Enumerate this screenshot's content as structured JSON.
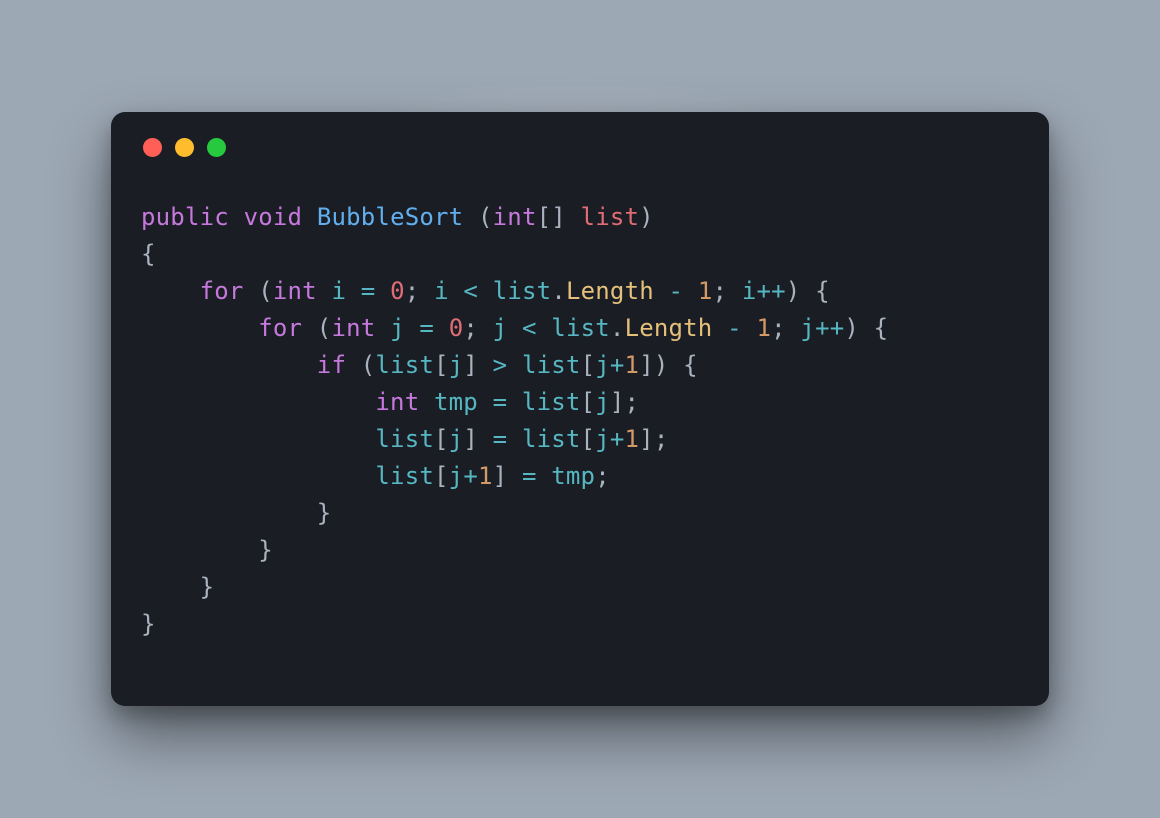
{
  "window": {
    "traffic_lights": [
      "red",
      "yellow",
      "green"
    ]
  },
  "code": {
    "tokens": [
      [
        [
          "k",
          "public"
        ],
        [
          "p",
          " "
        ],
        [
          "k",
          "void"
        ],
        [
          "p",
          " "
        ],
        [
          "fn",
          "BubbleSort"
        ],
        [
          "p",
          " ("
        ],
        [
          "t",
          "int"
        ],
        [
          "p",
          "[] "
        ],
        [
          "param",
          "list"
        ],
        [
          "p",
          ")"
        ]
      ],
      [
        [
          "p",
          "{"
        ]
      ],
      [
        [
          "p",
          "    "
        ],
        [
          "k",
          "for"
        ],
        [
          "p",
          " ("
        ],
        [
          "t",
          "int"
        ],
        [
          "p",
          " "
        ],
        [
          "v",
          "i"
        ],
        [
          "p",
          " "
        ],
        [
          "o",
          "="
        ],
        [
          "p",
          " "
        ],
        [
          "z",
          "0"
        ],
        [
          "p",
          "; "
        ],
        [
          "v",
          "i"
        ],
        [
          "p",
          " "
        ],
        [
          "o",
          "<"
        ],
        [
          "p",
          " "
        ],
        [
          "v",
          "list"
        ],
        [
          "p",
          "."
        ],
        [
          "prop",
          "Length"
        ],
        [
          "p",
          " "
        ],
        [
          "o",
          "-"
        ],
        [
          "p",
          " "
        ],
        [
          "one",
          "1"
        ],
        [
          "p",
          "; "
        ],
        [
          "v",
          "i"
        ],
        [
          "o",
          "++"
        ],
        [
          "p",
          ") {"
        ]
      ],
      [
        [
          "p",
          "        "
        ],
        [
          "k",
          "for"
        ],
        [
          "p",
          " ("
        ],
        [
          "t",
          "int"
        ],
        [
          "p",
          " "
        ],
        [
          "v",
          "j"
        ],
        [
          "p",
          " "
        ],
        [
          "o",
          "="
        ],
        [
          "p",
          " "
        ],
        [
          "z",
          "0"
        ],
        [
          "p",
          "; "
        ],
        [
          "v",
          "j"
        ],
        [
          "p",
          " "
        ],
        [
          "o",
          "<"
        ],
        [
          "p",
          " "
        ],
        [
          "v",
          "list"
        ],
        [
          "p",
          "."
        ],
        [
          "prop",
          "Length"
        ],
        [
          "p",
          " "
        ],
        [
          "o",
          "-"
        ],
        [
          "p",
          " "
        ],
        [
          "one",
          "1"
        ],
        [
          "p",
          "; "
        ],
        [
          "v",
          "j"
        ],
        [
          "o",
          "++"
        ],
        [
          "p",
          ") {"
        ]
      ],
      [
        [
          "p",
          "            "
        ],
        [
          "k",
          "if"
        ],
        [
          "p",
          " ("
        ],
        [
          "v",
          "list"
        ],
        [
          "p",
          "["
        ],
        [
          "v",
          "j"
        ],
        [
          "p",
          "] "
        ],
        [
          "o",
          ">"
        ],
        [
          "p",
          " "
        ],
        [
          "v",
          "list"
        ],
        [
          "p",
          "["
        ],
        [
          "v",
          "j"
        ],
        [
          "o",
          "+"
        ],
        [
          "one",
          "1"
        ],
        [
          "p",
          "]) {"
        ]
      ],
      [
        [
          "p",
          "                "
        ],
        [
          "t",
          "int"
        ],
        [
          "p",
          " "
        ],
        [
          "v",
          "tmp"
        ],
        [
          "p",
          " "
        ],
        [
          "o",
          "="
        ],
        [
          "p",
          " "
        ],
        [
          "v",
          "list"
        ],
        [
          "p",
          "["
        ],
        [
          "v",
          "j"
        ],
        [
          "p",
          "];"
        ]
      ],
      [
        [
          "p",
          "                "
        ],
        [
          "v",
          "list"
        ],
        [
          "p",
          "["
        ],
        [
          "v",
          "j"
        ],
        [
          "p",
          "] "
        ],
        [
          "o",
          "="
        ],
        [
          "p",
          " "
        ],
        [
          "v",
          "list"
        ],
        [
          "p",
          "["
        ],
        [
          "v",
          "j"
        ],
        [
          "o",
          "+"
        ],
        [
          "one",
          "1"
        ],
        [
          "p",
          "];"
        ]
      ],
      [
        [
          "p",
          "                "
        ],
        [
          "v",
          "list"
        ],
        [
          "p",
          "["
        ],
        [
          "v",
          "j"
        ],
        [
          "o",
          "+"
        ],
        [
          "one",
          "1"
        ],
        [
          "p",
          "] "
        ],
        [
          "o",
          "="
        ],
        [
          "p",
          " "
        ],
        [
          "v",
          "tmp"
        ],
        [
          "p",
          ";"
        ]
      ],
      [
        [
          "p",
          "            }"
        ]
      ],
      [
        [
          "p",
          "        }"
        ]
      ],
      [
        [
          "p",
          "    }"
        ]
      ],
      [
        [
          "p",
          "}"
        ]
      ]
    ]
  }
}
